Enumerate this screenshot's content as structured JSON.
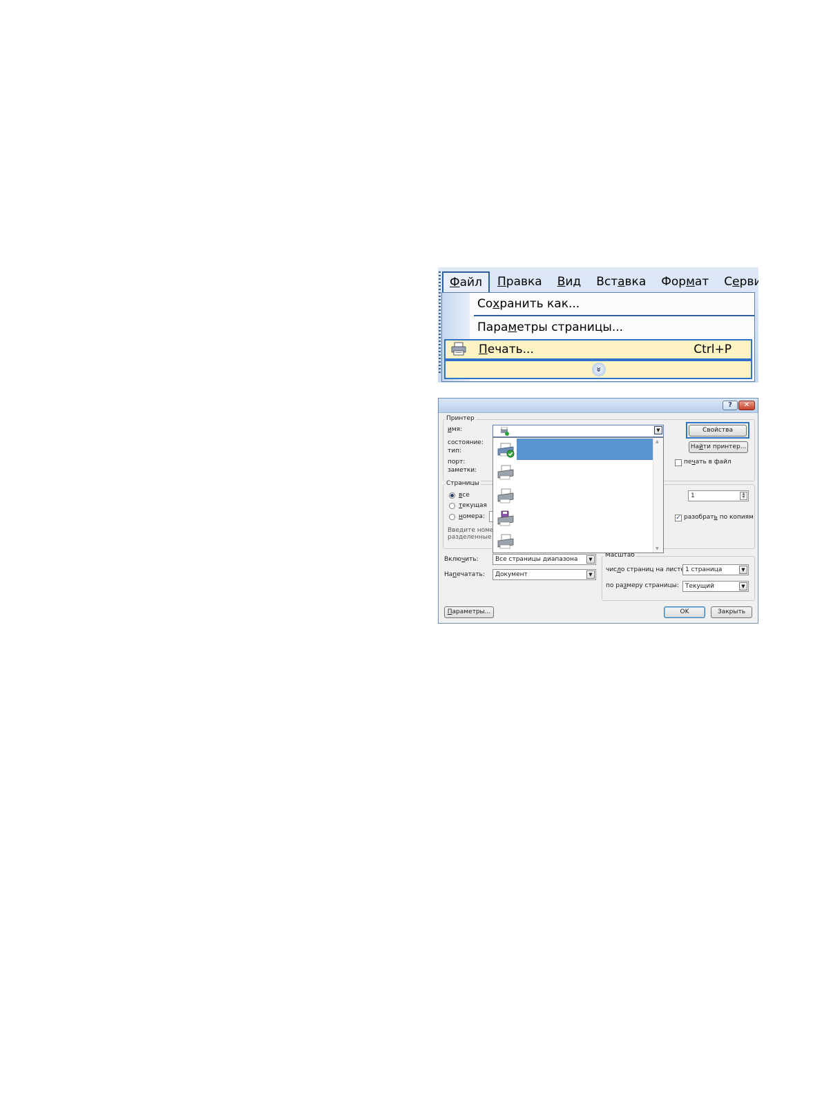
{
  "menu": {
    "bar": [
      {
        "name": "menu-file",
        "pre": "",
        "ul": "Ф",
        "post": "айл",
        "open": true
      },
      {
        "name": "menu-edit",
        "pre": "",
        "ul": "П",
        "post": "равка",
        "open": false
      },
      {
        "name": "menu-view",
        "pre": "",
        "ul": "В",
        "post": "ид",
        "open": false
      },
      {
        "name": "menu-insert",
        "pre": "Вст",
        "ul": "а",
        "post": "вка",
        "open": false
      },
      {
        "name": "menu-format",
        "pre": "Фор",
        "ul": "м",
        "post": "ат",
        "open": false
      },
      {
        "name": "menu-tools",
        "pre": "С",
        "ul": "е",
        "post": "рвис",
        "open": false
      }
    ],
    "items": {
      "save_as": {
        "pre": "Со",
        "ul": "х",
        "post": "ранить как..."
      },
      "page_setup": {
        "pre": "Пара",
        "ul": "м",
        "post": "етры страницы..."
      },
      "print": {
        "pre": "",
        "ul": "П",
        "post": "ечать...",
        "shortcut": "Ctrl+P"
      }
    },
    "expand_glyph": "»"
  },
  "dialog": {
    "help_glyph": "?",
    "close_glyph": "✕",
    "printer_group": "Принтер",
    "name_label": {
      "pre": "",
      "ul": "и",
      "post": "мя:"
    },
    "status_label": "состояние:",
    "type_label": "тип:",
    "port_label": "порт:",
    "notes_label": "заметки:",
    "properties_button": "Свойства",
    "find_printer_button": {
      "pre": "На",
      "ul": "й",
      "post": "ти принтер..."
    },
    "print_to_file": {
      "pre": "пе",
      "ul": "ч",
      "post": "ать в файл"
    },
    "pages_group": "Страницы",
    "all": {
      "pre": "",
      "ul": "в",
      "post": "се"
    },
    "current": {
      "pre": "",
      "ul": "т",
      "post": "екущая"
    },
    "numbers": {
      "pre": "",
      "ul": "н",
      "post": "омера:"
    },
    "hint_line1": "Введите номер",
    "hint_line2": "разделенные з",
    "copies_value": "1",
    "collate": {
      "pre": "разобрат",
      "ul": "ь",
      "post": " по копиям"
    },
    "include_label": {
      "pre": "Вклю",
      "ul": "ч",
      "post": "ить:"
    },
    "include_value": "Все страницы диапазона",
    "print_what_label": {
      "pre": "На",
      "ul": "п",
      "post": "ечатать:"
    },
    "print_what_value": "Документ",
    "scale_group": "Масштаб",
    "pages_per_sheet_label": {
      "pre": "чис",
      "ul": "л",
      "post": "о страниц на листе:"
    },
    "pages_per_sheet_value": "1 страница",
    "fit_to_label": {
      "pre": "по ра",
      "ul": "з",
      "post": "меру страницы:"
    },
    "fit_to_value": "Текущий",
    "options_button": {
      "pre": "",
      "ul": "П",
      "post": "араметры..."
    },
    "ok_button": "OK",
    "close_button": "Закрыть",
    "arrow_down": "▼",
    "arrow_up_small": "▲",
    "printer_rows": 5
  },
  "colors": {
    "selection": "#5a94cf",
    "highlight": "#fdf3c3",
    "accent_border": "#2f72c8"
  }
}
